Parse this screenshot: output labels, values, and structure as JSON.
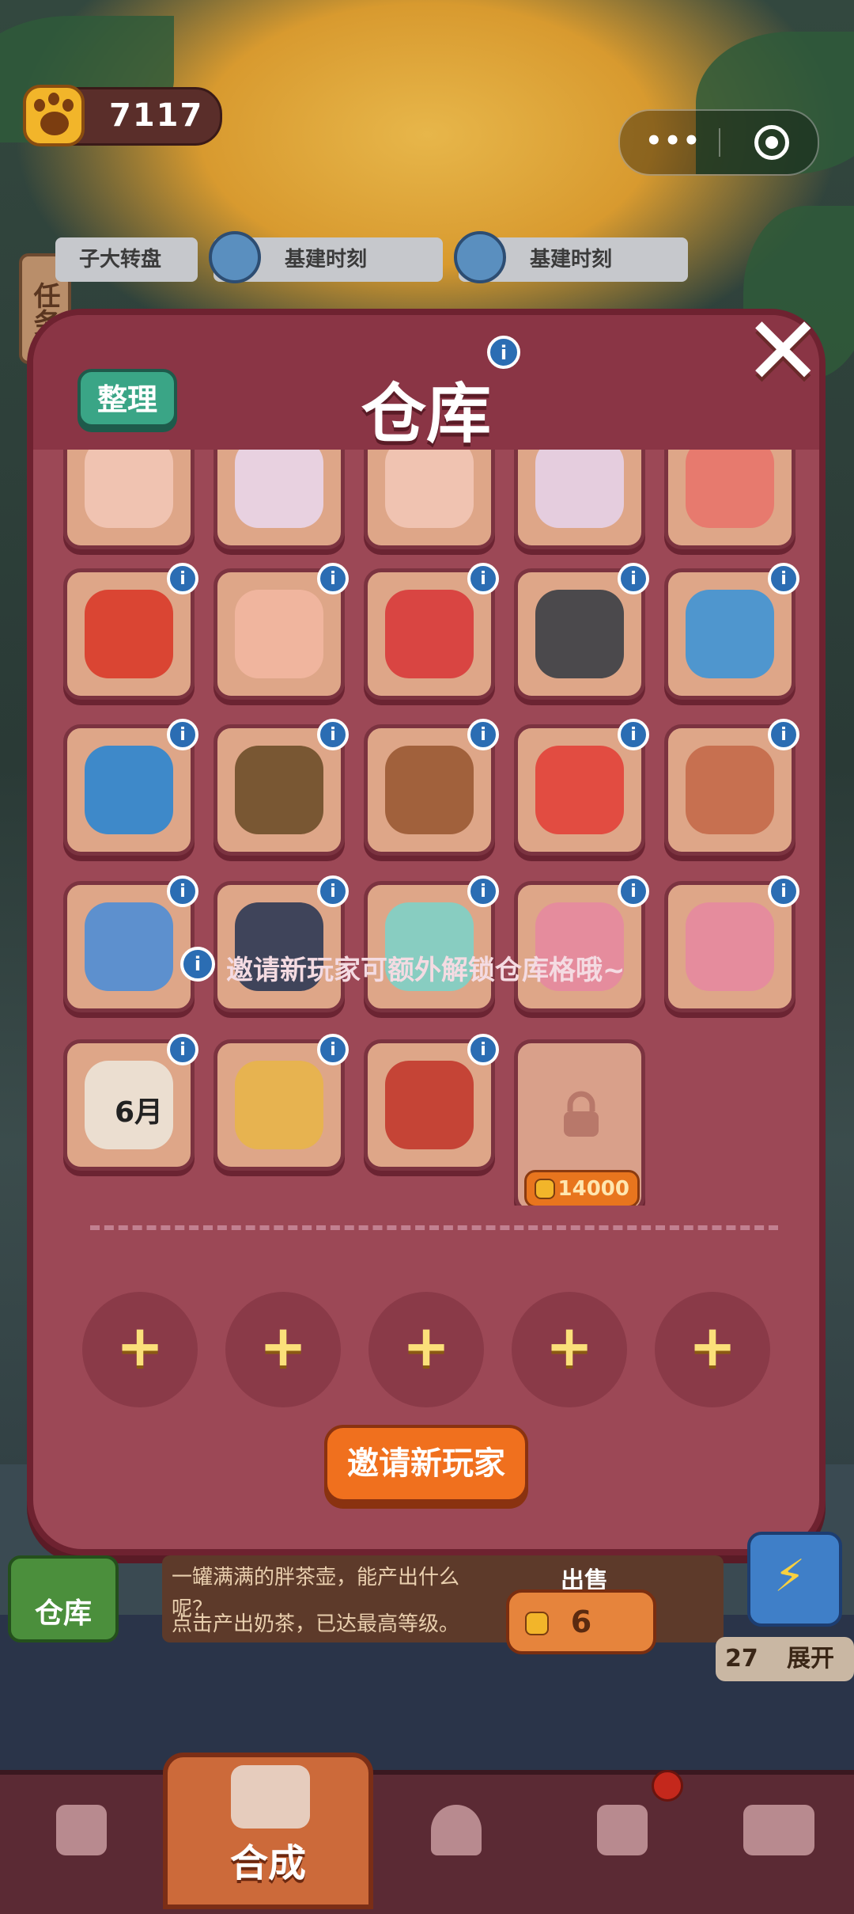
{
  "top_bar": {
    "paw_coins": "7117",
    "capsule_more": "•••"
  },
  "side_tab": {
    "task_label": "任务"
  },
  "banners": [
    {
      "label": "子大转盘"
    },
    {
      "label": "基建时刻"
    },
    {
      "label": "基建时刻"
    }
  ],
  "panel": {
    "title": "仓库",
    "sort_label": "整理",
    "close_label": "✕",
    "info_glyph": "i"
  },
  "grid_items": [
    {
      "name": "glass-jar-item",
      "color": "#f2c6b6"
    },
    {
      "name": "floral-vase-item",
      "color": "#e9d6ea"
    },
    {
      "name": "glass-jar-item",
      "color": "#f2c6b6"
    },
    {
      "name": "vase-with-tag-item",
      "color": "#e6d2e8"
    },
    {
      "name": "red-lamp-base-item",
      "color": "#e8756c"
    },
    {
      "name": "double-happiness-item",
      "color": "#d93b2a"
    },
    {
      "name": "folded-paper-item",
      "color": "#f2b7a1"
    },
    {
      "name": "red-helmet-item",
      "color": "#d83b3b"
    },
    {
      "name": "goggles-item",
      "color": "#3b3f46"
    },
    {
      "name": "small-fish-item",
      "color": "#3f95d6"
    },
    {
      "name": "tropical-fish-item",
      "color": "#2c86d0"
    },
    {
      "name": "dried-tea-mat-item",
      "color": "#6e4f2a"
    },
    {
      "name": "tea-bowl-item",
      "color": "#9a5a34"
    },
    {
      "name": "red-pouch-item",
      "color": "#e2433a"
    },
    {
      "name": "wooden-ladle-item",
      "color": "#c46a4a"
    },
    {
      "name": "blue-bag-item",
      "color": "#4f8ed6"
    },
    {
      "name": "clapperboard-item",
      "color": "#2d3a55"
    },
    {
      "name": "cream-jar-item",
      "color": "#7ed1c8"
    },
    {
      "name": "pink-razor-item",
      "color": "#e58aa0"
    },
    {
      "name": "pink-razor-item",
      "color": "#e58aa0"
    },
    {
      "name": "calendar-item",
      "color": "#ece4d8",
      "calendar_day": "6",
      "calendar_month": "月"
    },
    {
      "name": "puppy-box-item",
      "color": "#e8b54a"
    },
    {
      "name": "opera-figure-item",
      "color": "#c23a2e"
    }
  ],
  "locked_slot": {
    "price": "14000"
  },
  "invite": {
    "tip": "邀请新玩家可额外解锁仓库格哦~",
    "plus_glyph": "+",
    "button_label": "邀请新玩家"
  },
  "item_detail": {
    "warehouse_label": "仓库",
    "desc_line1": "一罐满满的胖茶壶，能产出什么呢？",
    "desc_line2": "点击产出奶茶，已达最高等级。",
    "sell_label": "出售",
    "sell_price": "6",
    "box_count": "27",
    "expand_label": "展开"
  },
  "bottom_nav": {
    "active_label": "合成",
    "items": [
      "shop-icon",
      "merge-icon",
      "service-bell-icon",
      "map-pin-icon",
      "bus-icon"
    ]
  }
}
